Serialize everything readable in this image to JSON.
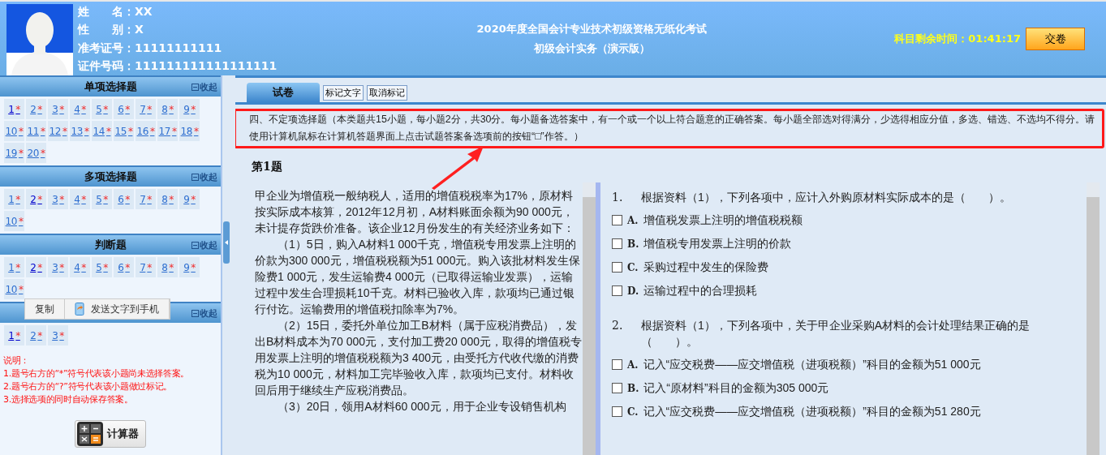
{
  "candidate": {
    "fields": [
      "姓　　名：XX",
      "性　　别：X",
      "准考证号：11111111111",
      "证件号码：111111111111111111"
    ]
  },
  "exam_title": [
    "2020年度全国会计专业技术初级资格无纸化考试",
    "初级会计实务（演示版）"
  ],
  "timer": {
    "label": "科目剩余时间：",
    "value": "01:41:17"
  },
  "submit_button": "交卷",
  "sections": [
    {
      "title": "单项选择题",
      "collapse": "收起",
      "items": [
        {
          "number": "1",
          "mark": "*",
          "visited": true
        },
        {
          "number": "2",
          "mark": "*",
          "visited": false
        },
        {
          "number": "3",
          "mark": "*",
          "visited": false
        },
        {
          "number": "4",
          "mark": "*",
          "visited": false
        },
        {
          "number": "5",
          "mark": "*",
          "visited": false
        },
        {
          "number": "6",
          "mark": "*",
          "visited": false
        },
        {
          "number": "7",
          "mark": "*",
          "visited": false
        },
        {
          "number": "8",
          "mark": "*",
          "visited": false
        },
        {
          "number": "9",
          "mark": "*",
          "visited": false
        },
        {
          "number": "10",
          "mark": "*",
          "visited": false
        },
        {
          "number": "11",
          "mark": "*",
          "visited": false
        },
        {
          "number": "12",
          "mark": "*",
          "visited": false
        },
        {
          "number": "13",
          "mark": "*",
          "visited": false
        },
        {
          "number": "14",
          "mark": "*",
          "visited": false
        },
        {
          "number": "15",
          "mark": "*",
          "visited": false
        },
        {
          "number": "16",
          "mark": "*",
          "visited": false
        },
        {
          "number": "17",
          "mark": "*",
          "visited": false
        },
        {
          "number": "18",
          "mark": "*",
          "visited": false
        },
        {
          "number": "19",
          "mark": "*",
          "visited": false
        },
        {
          "number": "20",
          "mark": "*",
          "visited": false
        }
      ]
    },
    {
      "title": "多项选择题",
      "collapse": "收起",
      "items": [
        {
          "number": "1",
          "mark": "*",
          "visited": false
        },
        {
          "number": "2",
          "mark": "*",
          "visited": true
        },
        {
          "number": "3",
          "mark": "*",
          "visited": false
        },
        {
          "number": "4",
          "mark": "*",
          "visited": false
        },
        {
          "number": "5",
          "mark": "*",
          "visited": false
        },
        {
          "number": "6",
          "mark": "*",
          "visited": false
        },
        {
          "number": "7",
          "mark": "*",
          "visited": false
        },
        {
          "number": "8",
          "mark": "*",
          "visited": false
        },
        {
          "number": "9",
          "mark": "*",
          "visited": false
        },
        {
          "number": "10",
          "mark": "*",
          "visited": false
        }
      ]
    },
    {
      "title": "判断题",
      "collapse": "收起",
      "items": [
        {
          "number": "1",
          "mark": "*",
          "visited": false
        },
        {
          "number": "2",
          "mark": "*",
          "visited": true
        },
        {
          "number": "3",
          "mark": "*",
          "visited": false
        },
        {
          "number": "4",
          "mark": "*",
          "visited": false
        },
        {
          "number": "5",
          "mark": "*",
          "visited": false
        },
        {
          "number": "6",
          "mark": "*",
          "visited": false
        },
        {
          "number": "7",
          "mark": "*",
          "visited": false
        },
        {
          "number": "8",
          "mark": "*",
          "visited": false
        },
        {
          "number": "9",
          "mark": "*",
          "visited": false
        },
        {
          "number": "10",
          "mark": "*",
          "visited": false
        }
      ]
    },
    {
      "collapse": "收起",
      "items": [
        {
          "number": "1",
          "mark": "*",
          "visited": true
        },
        {
          "number": "2",
          "mark": "*",
          "visited": false
        },
        {
          "number": "3",
          "mark": "*",
          "visited": false
        }
      ]
    }
  ],
  "context_menu": {
    "items": [
      {
        "label": "复制",
        "kind": "plain"
      },
      {
        "label": "发送文字到手机",
        "kind": "phone"
      }
    ]
  },
  "notes": {
    "title": "说明：",
    "lines": [
      "1.题号右方的“*”符号代表该小题尚未选择答案。",
      "2.题号右方的“?”符号代表该小题做过标记。",
      "3.选择选项的同时自动保存答案。"
    ]
  },
  "calculator_button": "计算器",
  "tabs": [
    {
      "label": "试卷",
      "selected": true
    }
  ],
  "tool_buttons": [
    "标记文字",
    "取消标记"
  ],
  "instruction": "四、不定项选择题（本类题共15小题，每小题2分，共30分。每小题备选答案中，有一个或一个以上符合题意的正确答案。每小题全部选对得满分，少选得相应分值，多选、错选、不选均不得分。请使用计算机鼠标在计算机答题界面上点击试题答案备选项前的按钮“□”作答。）",
  "question_title": "第1题",
  "material": [
    {
      "text": "甲企业为增值税一般纳税人，适用的增值税税率为17%，原材料按实际成本核算，2012年12月初，A材料账面余额为90 000元，未计提存货跌价准备。该企业12月份发生的有关经济业务如下：",
      "indent": false
    },
    {
      "text": "（1）5日，购入A材料1 000千克，增值税专用发票上注明的价款为300 000元，增值税税额为51 000元。购入该批材料发生保险费1 000元，发生运输费4 000元（已取得运输业发票），运输过程中发生合理损耗10千克。材料已验收入库，款项均已通过银行付讫。运输费用的增值税扣除率为7%。",
      "indent": true
    },
    {
      "text": "（2）15日，委托外单位加工B材料（属于应税消费品），发出B材料成本为70 000元，支付加工费20 000元，取得的增值税专用发票上注明的增值税税额为3 400元，由受托方代收代缴的消费税为10 000元，材料加工完毕验收入库，款项均已支付。材料收回后用于继续生产应税消费品。",
      "indent": true
    },
    {
      "text": "（3）20日，领用A材料60 000元，用于企业专设销售机构",
      "indent": true
    }
  ],
  "questions": [
    {
      "number": "1.",
      "text": "根据资料（1），下列各项中，应计入外购原材料实际成本的是（　　）。",
      "options": [
        {
          "letter": "A.",
          "text": "增值税发票上注明的增值税税额",
          "checked": false
        },
        {
          "letter": "B.",
          "text": "增值税专用发票上注明的价款",
          "checked": false
        },
        {
          "letter": "C.",
          "text": "采购过程中发生的保险费",
          "checked": false
        },
        {
          "letter": "D.",
          "text": "运输过程中的合理损耗",
          "checked": false
        }
      ]
    },
    {
      "number": "2.",
      "text": "根据资料（1），下列各项中，关于甲企业采购A材料的会计处理结果正确的是（　　）。",
      "options": [
        {
          "letter": "A.",
          "text": "记入“应交税费——应交增值税（进项税额）”科目的金额为51 000元",
          "checked": false
        },
        {
          "letter": "B.",
          "text": "记入“原材料”科目的金额为305 000元",
          "checked": false
        },
        {
          "letter": "C.",
          "text": "记入“应交税费——应交增值税（进项税额）”科目的金额为51 280元",
          "checked": false
        }
      ]
    }
  ]
}
